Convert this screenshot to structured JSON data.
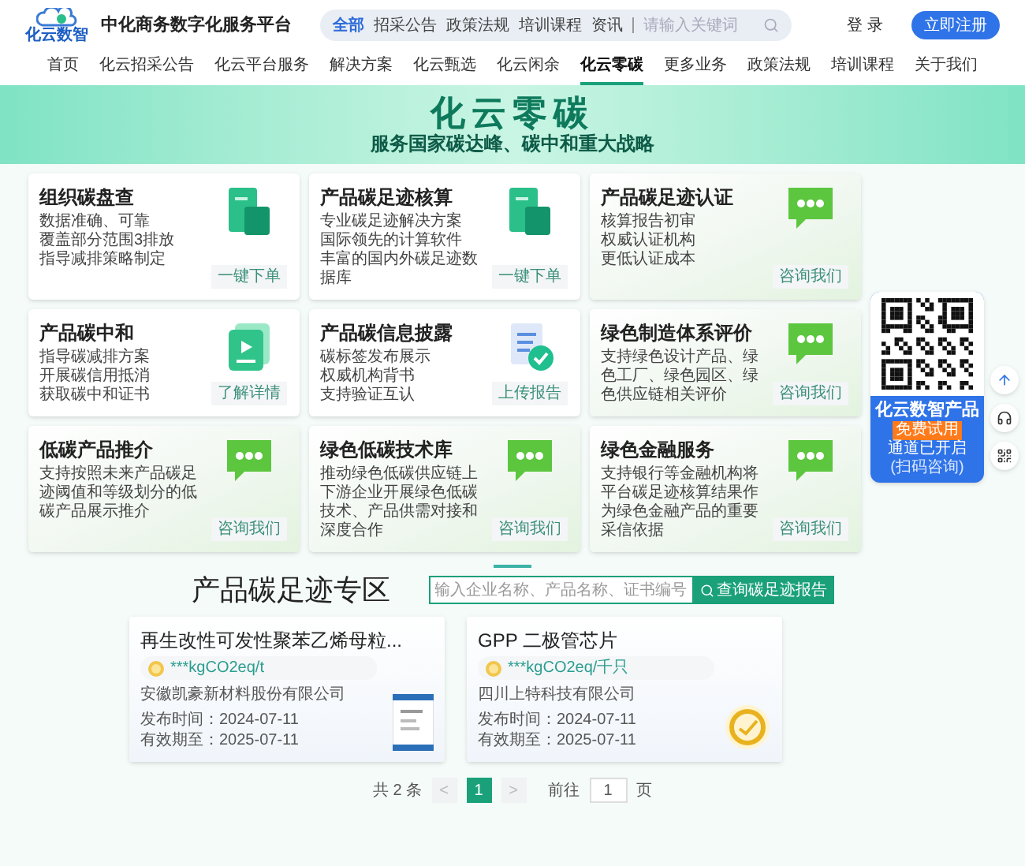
{
  "header": {
    "logo_text": "化云数智",
    "site_title": "中化商务数字化服务平台",
    "search": {
      "tabs": [
        {
          "label": "全部",
          "selected": true
        },
        {
          "label": "招采公告",
          "selected": false
        },
        {
          "label": "政策法规",
          "selected": false
        },
        {
          "label": "培训课程",
          "selected": false
        },
        {
          "label": "资讯",
          "selected": false
        }
      ],
      "placeholder": "请输入关键词"
    },
    "login": "登 录",
    "register": "立即注册"
  },
  "nav": [
    {
      "label": "首页",
      "selected": false
    },
    {
      "label": "化云招采公告",
      "selected": false
    },
    {
      "label": "化云平台服务",
      "selected": false
    },
    {
      "label": "解决方案",
      "selected": false
    },
    {
      "label": "化云甄选",
      "selected": false
    },
    {
      "label": "化云闲余",
      "selected": false
    },
    {
      "label": "化云零碳",
      "selected": true
    },
    {
      "label": "更多业务",
      "selected": false
    },
    {
      "label": "政策法规",
      "selected": false
    },
    {
      "label": "培训课程",
      "selected": false
    },
    {
      "label": "关于我们",
      "selected": false
    }
  ],
  "hero": {
    "title": "化云零碳",
    "subtitle": "服务国家碳达峰、碳中和重大战略"
  },
  "services": [
    {
      "kind": "document",
      "title": "组织碳盘查",
      "lines": [
        "数据准确、可靠",
        "覆盖部分范围3排放",
        "指导减排策略制定"
      ],
      "button": "一键下单"
    },
    {
      "kind": "document",
      "title": "产品碳足迹核算",
      "lines": [
        "专业碳足迹解决方案",
        "国际领先的计算软件",
        "丰富的国内外碳足迹数据库"
      ],
      "button": "一键下单"
    },
    {
      "kind": "chat",
      "title": "产品碳足迹认证",
      "lines": [
        "核算报告初审",
        "权威认证机构",
        "更低认证成本"
      ],
      "button": "咨询我们"
    },
    {
      "kind": "video",
      "title": "产品碳中和",
      "lines": [
        "指导碳减排方案",
        "开展碳信用抵消",
        "获取碳中和证书"
      ],
      "button": "了解详情"
    },
    {
      "kind": "report",
      "title": "产品碳信息披露",
      "lines": [
        "碳标签发布展示",
        "权威机构背书",
        "支持验证互认"
      ],
      "button": "上传报告"
    },
    {
      "kind": "chat",
      "title": "绿色制造体系评价",
      "lines": [
        "支持绿色设计产品、绿色工厂、绿色园区、绿色供应链相关评价"
      ],
      "button": "咨询我们"
    },
    {
      "kind": "chat",
      "title": "低碳产品推介",
      "lines": [
        "支持按照未来产品碳足迹阈值和等级划分的低碳产品展示推介"
      ],
      "button": "咨询我们"
    },
    {
      "kind": "chat",
      "title": "绿色低碳技术库",
      "lines": [
        "推动绿色低碳供应链上下游企业开展绿色低碳技术、产品供需对接和深度合作"
      ],
      "button": "咨询我们"
    },
    {
      "kind": "chat",
      "title": "绿色金融服务",
      "lines": [
        "支持银行等金融机构将平台碳足迹核算结果作为绿色金融产品的重要采信依据"
      ],
      "button": "咨询我们"
    }
  ],
  "promo": {
    "title": "化云数智产品",
    "badge": "免费试用",
    "text": "通道已开启",
    "note": "(扫码咨询)"
  },
  "zone": {
    "title": "产品碳足迹专区",
    "search_placeholder": "输入企业名称、产品名称、证书编号",
    "search_button": "查询碳足迹报告"
  },
  "products": [
    {
      "kind": "certificate",
      "title": "再生改性可发性聚苯乙烯母粒...",
      "value": "***kgCO2eq/t",
      "company": "安徽凯豪新材料股份有限公司",
      "published": "发布时间：2024-07-11",
      "expires": "有效期至：2025-07-11"
    },
    {
      "kind": "seal",
      "title": "GPP 二极管芯片",
      "value": "***kgCO2eq/千只",
      "company": "四川上特科技有限公司",
      "published": "发布时间：2024-07-11",
      "expires": "有效期至：2025-07-11"
    }
  ],
  "pagination": {
    "total": "共 2 条",
    "prev": "<",
    "pages": [
      {
        "label": "1",
        "selected": true
      }
    ],
    "next": ">",
    "goto": "前往",
    "page_value": "1",
    "unit": "页"
  }
}
